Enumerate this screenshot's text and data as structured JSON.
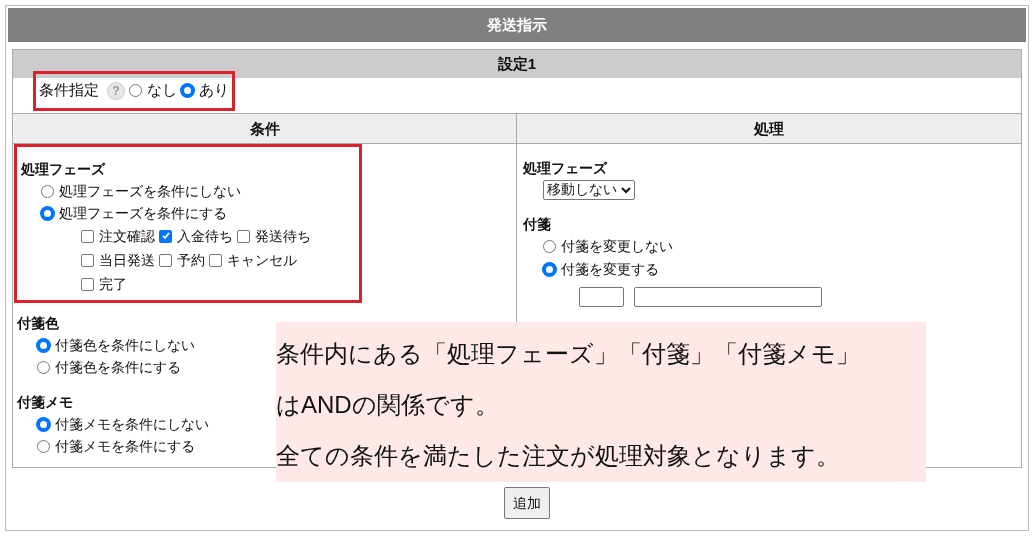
{
  "title": "発送指示",
  "setting": {
    "title": "設定1",
    "label": "条件指定",
    "help": "?",
    "options": [
      {
        "label": "なし",
        "selected": false
      },
      {
        "label": "あり",
        "selected": true
      }
    ]
  },
  "conditions": {
    "header": "条件",
    "sections": [
      {
        "title": "処理フェーズ",
        "options": [
          {
            "label": "処理フェーズを条件にしない",
            "selected": false
          },
          {
            "label": "処理フェーズを条件にする",
            "selected": true
          }
        ],
        "checkbox_rows": [
          [
            {
              "label": "注文確認",
              "checked": false
            },
            {
              "label": "入金待ち",
              "checked": true
            },
            {
              "label": "発送待ち",
              "checked": false
            }
          ],
          [
            {
              "label": "当日発送",
              "checked": false
            },
            {
              "label": "予約",
              "checked": false
            },
            {
              "label": "キャンセル",
              "checked": false
            }
          ],
          [
            {
              "label": "完了",
              "checked": false
            }
          ]
        ]
      },
      {
        "title": "付箋色",
        "options": [
          {
            "label": "付箋色を条件にしない",
            "selected": true
          },
          {
            "label": "付箋色を条件にする",
            "selected": false
          }
        ]
      },
      {
        "title": "付箋メモ",
        "options": [
          {
            "label": "付箋メモを条件にしない",
            "selected": true
          },
          {
            "label": "付箋メモを条件にする",
            "selected": false
          }
        ]
      }
    ]
  },
  "actions": {
    "header": "処理",
    "phase": {
      "title": "処理フェーズ",
      "value": "移動しない"
    },
    "tag": {
      "title": "付箋",
      "options": [
        {
          "label": "付箋を変更しない",
          "selected": false
        },
        {
          "label": "付箋を変更する",
          "selected": true
        }
      ]
    }
  },
  "note": [
    "条件内にある「処理フェーズ」「付箋」「付箋メモ」",
    "はANDの関係です。",
    "全ての条件を満たした注文が処理対象となります。"
  ],
  "add_button": "追加"
}
